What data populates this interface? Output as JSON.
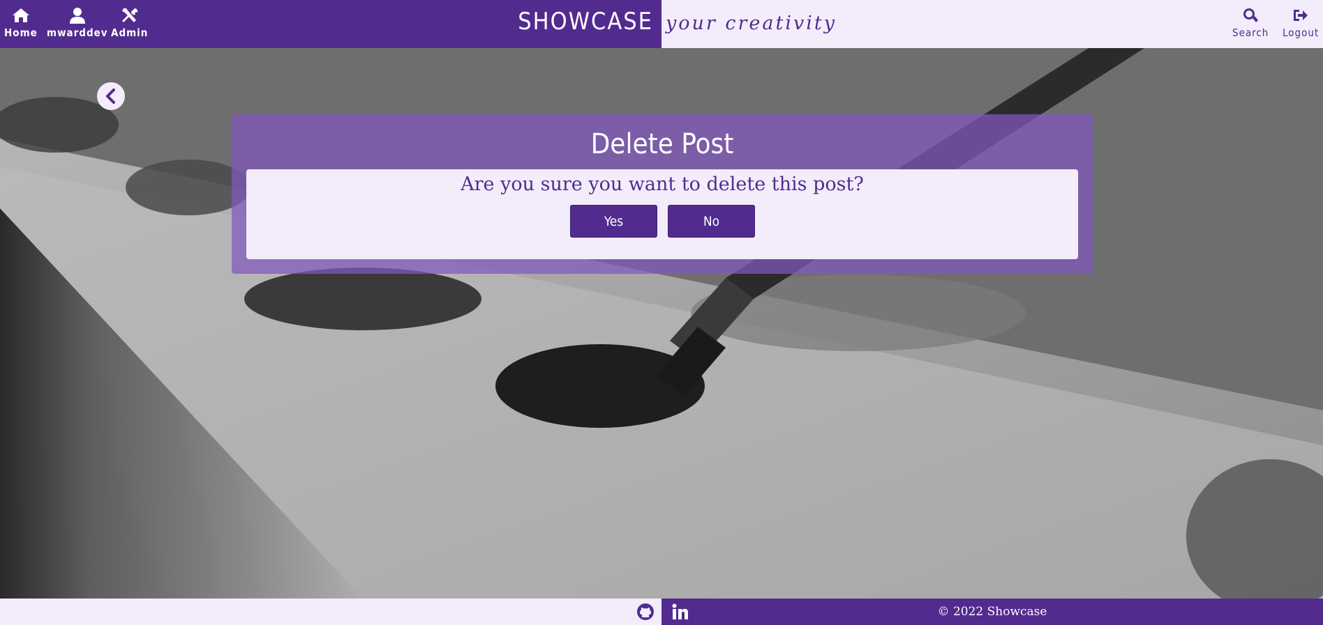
{
  "header": {
    "nav": {
      "home": {
        "label": "Home",
        "icon": "home-icon"
      },
      "profile": {
        "label": "mwarddev",
        "icon": "user-icon"
      },
      "admin": {
        "label": "Admin",
        "icon": "tools-icon"
      }
    },
    "brand": "SHOWCASE",
    "tagline": "your creativity",
    "search": {
      "label": "Search",
      "icon": "search-icon"
    },
    "logout": {
      "label": "Logout",
      "icon": "logout-icon"
    }
  },
  "back_button": {
    "icon": "chevron-left-icon"
  },
  "modal": {
    "title": "Delete Post",
    "question": "Are you sure you want to delete this post?",
    "yes_label": "Yes",
    "no_label": "No"
  },
  "footer": {
    "github_icon": "github-icon",
    "linkedin_icon": "linkedin-icon",
    "copyright": "© 2022 Showcase"
  },
  "colors": {
    "primary": "#522b8f",
    "light": "#f3edfb",
    "modal_overlay": "#8258be"
  }
}
